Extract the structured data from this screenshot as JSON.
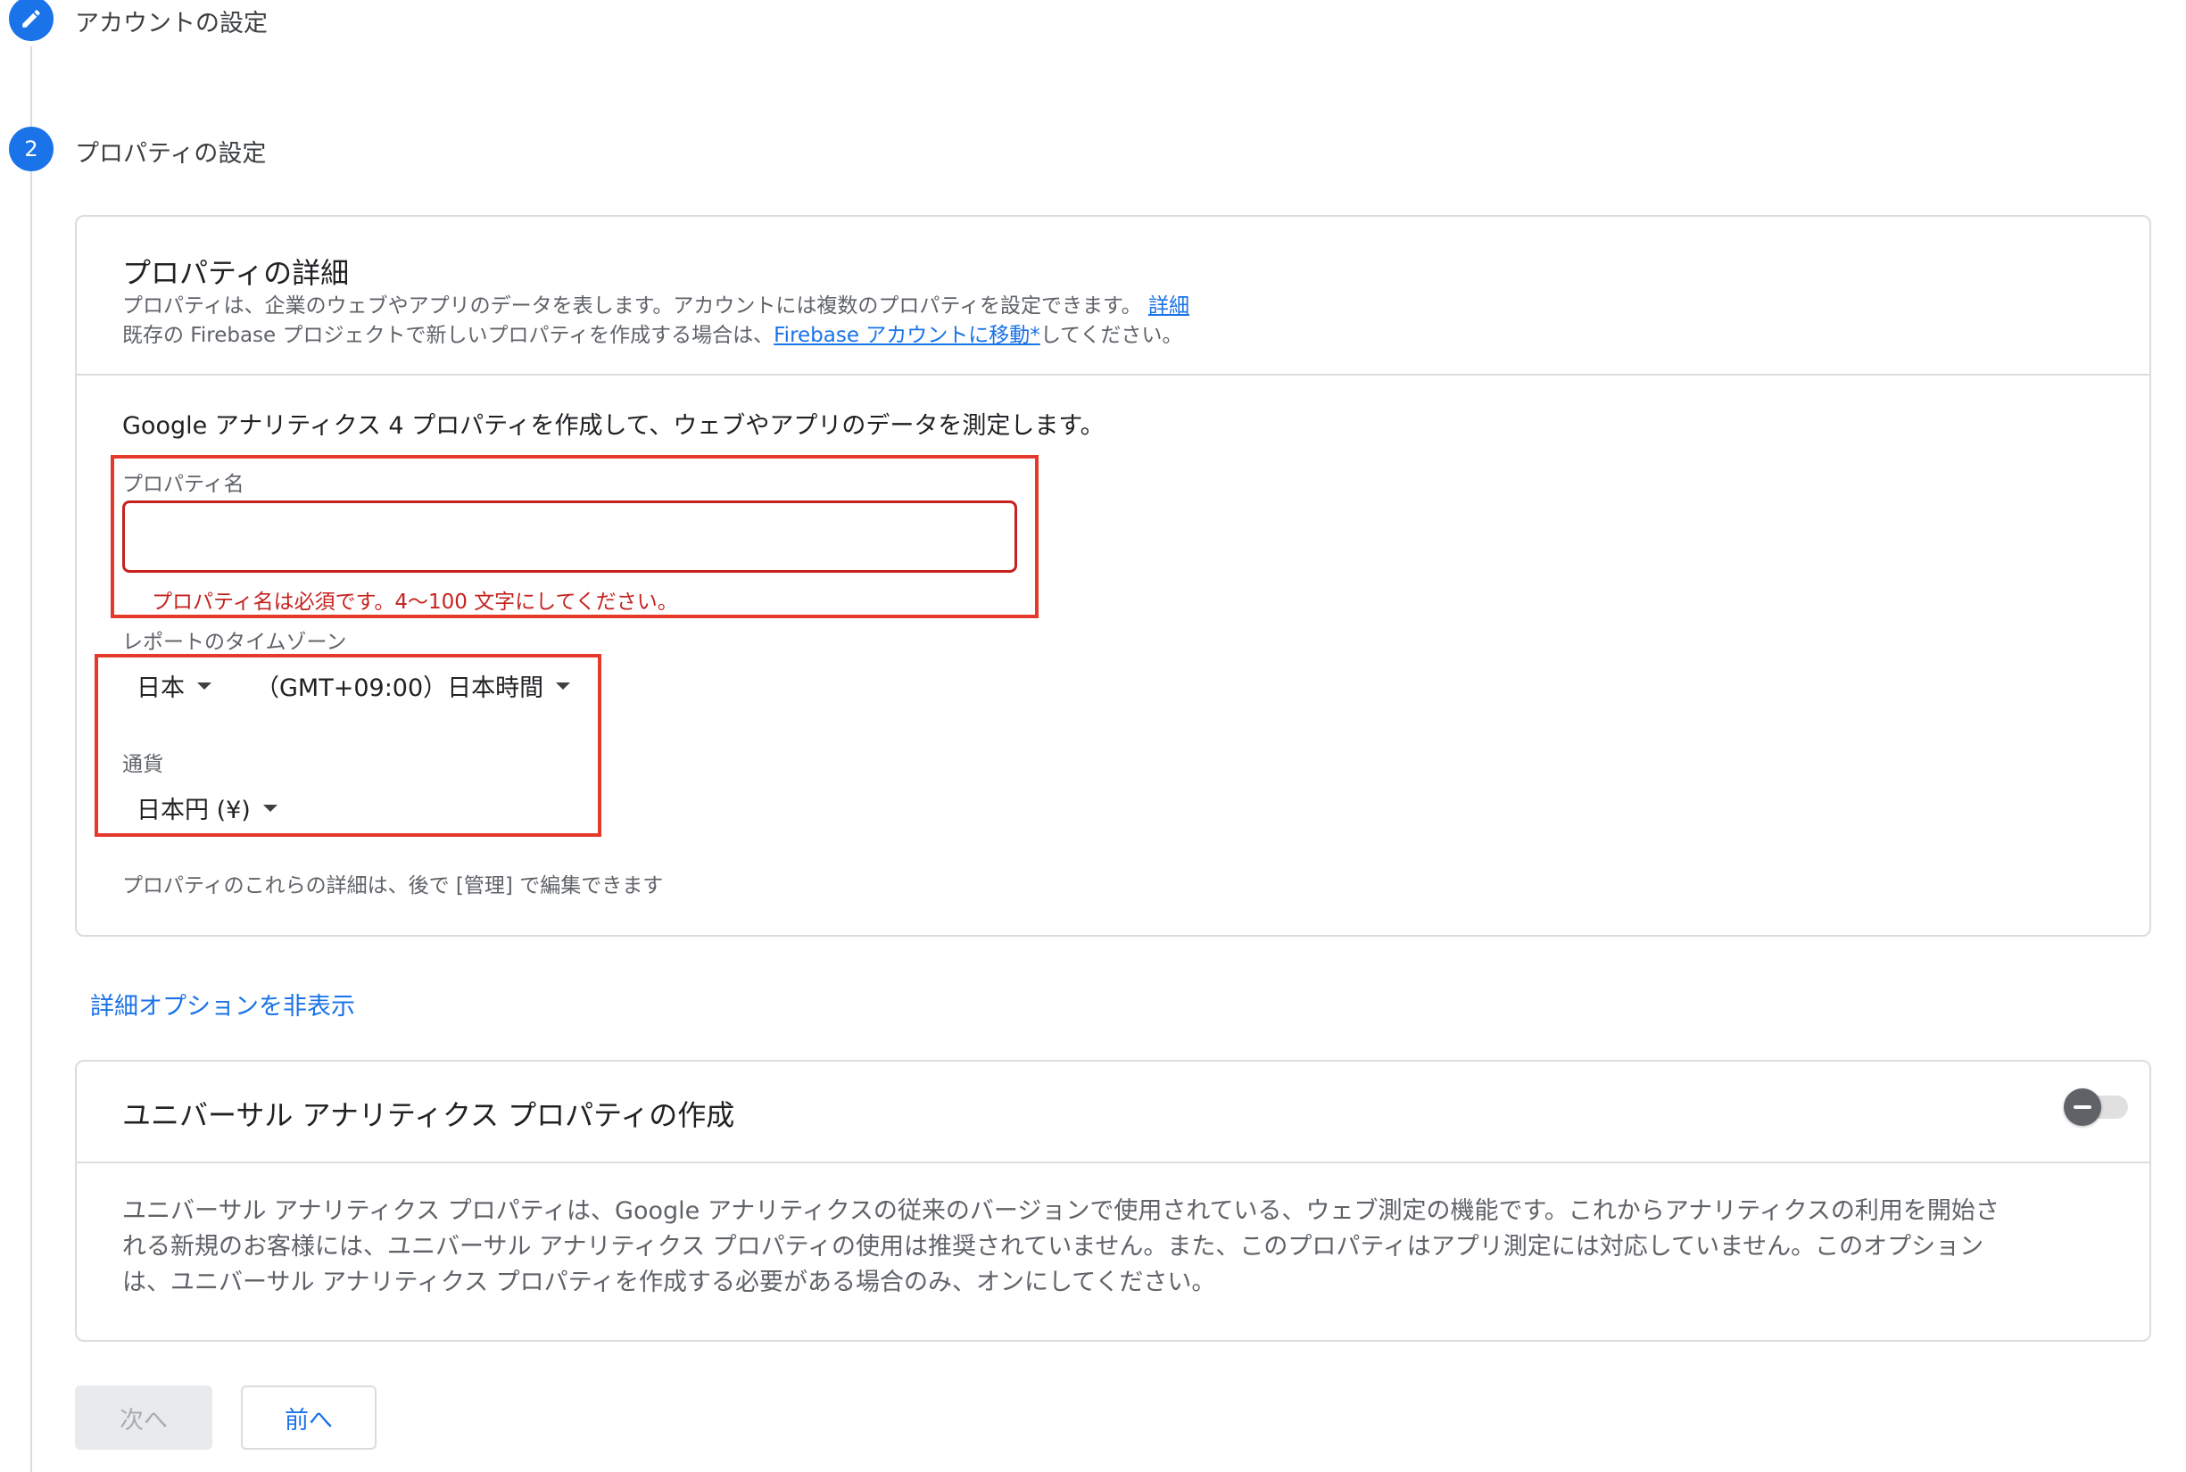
{
  "steps": {
    "step1_label": "アカウントの設定",
    "step2_number": "2",
    "step2_label": "プロパティの設定"
  },
  "details_card": {
    "title": "プロパティの詳細",
    "desc_line1": "プロパティは、企業のウェブやアプリのデータを表します。アカウントには複数のプロパティを設定できます。",
    "desc_link": "詳細",
    "desc_line2_prefix": "既存の Firebase プロジェクトで新しいプロパティを作成する場合は、",
    "desc_line2_link": "Firebase アカウントに移動*",
    "desc_line2_suffix": "してください。",
    "intro": "Google アナリティクス 4 プロパティを作成して、ウェブやアプリのデータを測定します。",
    "property_name": {
      "label": "プロパティ名",
      "value": "",
      "error": "プロパティ名は必須です。4〜100 文字にしてください。"
    },
    "timezone": {
      "label": "レポートのタイムゾーン",
      "country": "日本",
      "zone": "（GMT+09:00）日本時間"
    },
    "currency": {
      "label": "通貨",
      "value": "日本円 (¥)"
    },
    "footnote": "プロパティのこれらの詳細は、後で [管理] で編集できます"
  },
  "advanced_link": "詳細オプションを非表示",
  "ua_card": {
    "title": "ユニバーサル アナリティクス プロパティの作成",
    "toggle_on": false,
    "body_line1": "ユニバーサル アナリティクス プロパティは、Google アナリティクスの従来のバージョンで使用されている、ウェブ測定の機能です。これからアナリティクスの利用を開始さ",
    "body_line2": "れる新規のお客様には、ユニバーサル アナリティクス プロパティの使用は推奨されていません。また、このプロパティはアプリ測定には対応していません。このオプション",
    "body_line3": "は、ユニバーサル アナリティクス プロパティを作成する必要がある場合のみ、オンにしてください。"
  },
  "buttons": {
    "next": "次へ",
    "back": "前へ"
  },
  "colors": {
    "accent": "#1a73e8",
    "error": "#c5221f",
    "highlight_box": "#e5392b"
  }
}
